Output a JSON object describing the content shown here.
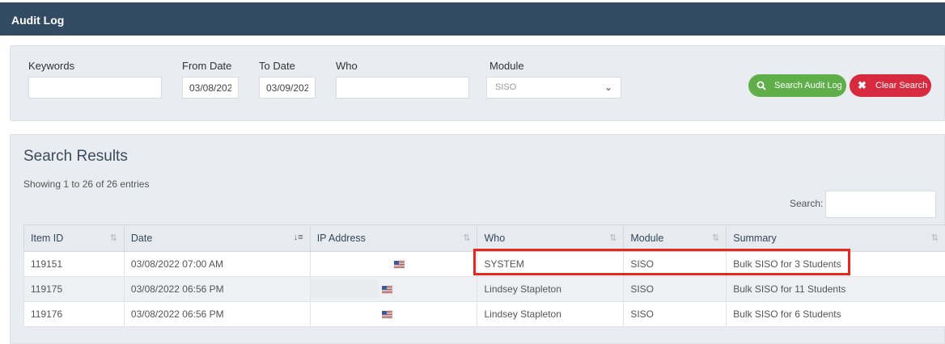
{
  "header": {
    "title": "Audit Log"
  },
  "filters": {
    "keywords_label": "Keywords",
    "keywords_value": "",
    "from_date_label": "From Date",
    "from_date_value": "03/08/202",
    "to_date_label": "To Date",
    "to_date_value": "03/09/202",
    "who_label": "Who",
    "who_value": "",
    "module_label": "Module",
    "module_value": "SISO",
    "search_button": "Search Audit Log",
    "clear_button": "Clear Search",
    "search_icon": "magnifier-icon",
    "clear_icon": "x-icon"
  },
  "results": {
    "title": "Search Results",
    "count_text": "Showing 1 to 26 of 26 entries",
    "search_label": "Search:",
    "columns": [
      "Item ID",
      "Date",
      "IP Address",
      "Who",
      "Module",
      "Summary"
    ],
    "rows": [
      {
        "item_id": "119151",
        "date": "03/08/2022 07:00 AM",
        "who": "SYSTEM",
        "module": "SISO",
        "summary": "Bulk SISO for 3 Students"
      },
      {
        "item_id": "119175",
        "date": "03/08/2022 06:56 PM",
        "who": "Lindsey Stapleton",
        "module": "SISO",
        "summary": "Bulk SISO for 11 Students"
      },
      {
        "item_id": "119176",
        "date": "03/08/2022 06:56 PM",
        "who": "Lindsey Stapleton",
        "module": "SISO",
        "summary": "Bulk SISO for 6 Students"
      }
    ]
  },
  "colors": {
    "header_bg": "#334a63",
    "search_btn": "#5fae49",
    "clear_btn": "#d72a3e",
    "highlight": "#e8251f"
  }
}
